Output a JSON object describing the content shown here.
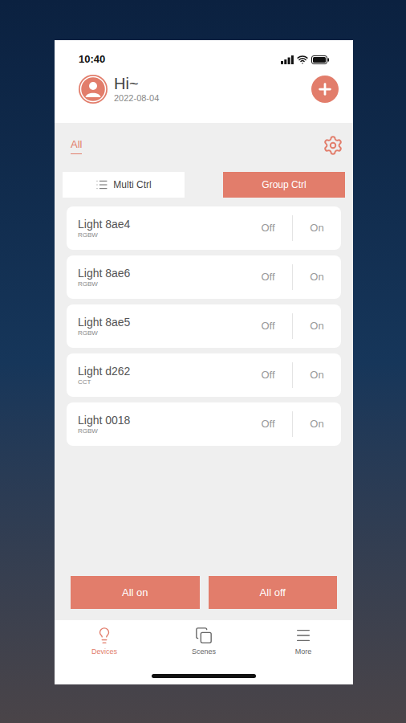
{
  "status_bar": {
    "time": "10:40"
  },
  "header": {
    "greeting": "Hi~",
    "date": "2022-08-04"
  },
  "tabs": [
    {
      "label": "All",
      "selected": true
    }
  ],
  "controls": [
    {
      "label": "Multi Ctrl",
      "selected": false
    },
    {
      "label": "Group Ctrl",
      "selected": true
    }
  ],
  "lights": [
    {
      "name": "Light 8ae4",
      "type": "RGBW",
      "off": "Off",
      "on": "On"
    },
    {
      "name": "Light 8ae6",
      "type": "RGBW",
      "off": "Off",
      "on": "On"
    },
    {
      "name": "Light 8ae5",
      "type": "RGBW",
      "off": "Off",
      "on": "On"
    },
    {
      "name": "Light d262",
      "type": "CCT",
      "off": "Off",
      "on": "On"
    },
    {
      "name": "Light 0018",
      "type": "RGBW",
      "off": "Off",
      "on": "On"
    }
  ],
  "actions": [
    "All on",
    "All off"
  ],
  "nav": [
    {
      "label": "Devices",
      "selected": true
    },
    {
      "label": "Scenes",
      "selected": false
    },
    {
      "label": "More",
      "selected": false
    }
  ]
}
